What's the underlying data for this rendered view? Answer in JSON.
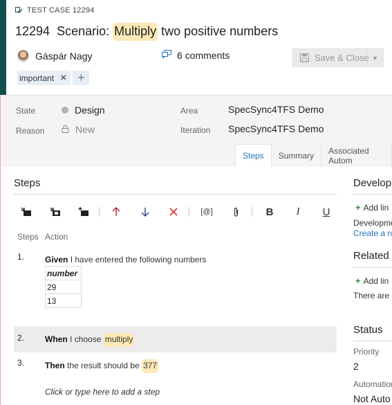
{
  "header": {
    "work_item_type": "TEST CASE 12294",
    "title_id": "12294",
    "title_pre": "Scenario: ",
    "title_highlight": "Multiply",
    "title_post": " two positive numbers",
    "author": "Gáspár Nagy",
    "comments": "6 comments",
    "save_label": "Save & Close",
    "tags": [
      "important"
    ]
  },
  "fields": {
    "state_label": "State",
    "state_value": "Design",
    "reason_label": "Reason",
    "reason_value": "New",
    "area_label": "Area",
    "area_value": "SpecSync4TFS Demo",
    "iteration_label": "Iteration",
    "iteration_value": "SpecSync4TFS Demo"
  },
  "tabs": [
    "Steps",
    "Summary",
    "Associated Autom"
  ],
  "steps": {
    "heading": "Steps",
    "col_steps": "Steps",
    "col_action": "Action",
    "items": [
      {
        "num": "1.",
        "keyword": "Given",
        "text": " I have entered the following numbers"
      },
      {
        "num": "2.",
        "keyword": "When",
        "text": " I choose ",
        "highlight": "multiply"
      },
      {
        "num": "3.",
        "keyword": "Then",
        "text": " the result should be ",
        "highlight": "377"
      }
    ],
    "table_header": "number",
    "table_rows": [
      "29",
      "13"
    ],
    "add_prompt": "Click or type here to add a step"
  },
  "side": {
    "development_heading": "Develop",
    "add_link": "Add lin",
    "development_text": "Developme",
    "create_link": "Create a n",
    "related_heading": "Related",
    "related_add": "Add lin",
    "related_text": "There are n",
    "status_heading": "Status",
    "priority_label": "Priority",
    "priority_value": "2",
    "automation_label": "Automation",
    "automation_value": "Not Auto"
  },
  "colors": {
    "accent": "#0f4f4d",
    "highlight": "#fde9b6",
    "link": "#1e73be",
    "delete": "#d93b3b"
  }
}
